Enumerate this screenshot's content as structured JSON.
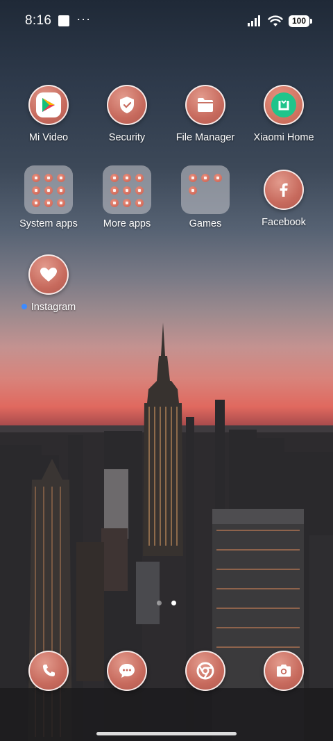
{
  "status_bar": {
    "time": "8:16",
    "more": "···",
    "battery": "100",
    "icons": [
      "notification-square-icon",
      "signal-icon",
      "wifi-icon",
      "battery-icon"
    ]
  },
  "apps": [
    {
      "label": "Mi Video",
      "icon": "play-icon"
    },
    {
      "label": "Security",
      "icon": "shield-check-icon"
    },
    {
      "label": "File Manager",
      "icon": "folder-icon"
    },
    {
      "label": "Xiaomi Home",
      "icon": "mi-home-icon"
    },
    {
      "label": "System apps",
      "icon": "folder-group-icon"
    },
    {
      "label": "More apps",
      "icon": "folder-group-icon"
    },
    {
      "label": "Games",
      "icon": "folder-group-icon"
    },
    {
      "label": "Facebook",
      "icon": "facebook-icon"
    },
    {
      "label": "Instagram",
      "icon": "heart-icon",
      "new_install_dot": true
    }
  ],
  "dock": [
    {
      "name": "phone",
      "icon": "phone-icon"
    },
    {
      "name": "messages",
      "icon": "message-icon"
    },
    {
      "name": "chrome",
      "icon": "chrome-icon"
    },
    {
      "name": "camera",
      "icon": "camera-icon"
    }
  ],
  "page_indicator": {
    "pages": 2,
    "active": 2
  },
  "colors": {
    "icon_fill": "#c76a5d",
    "dot_new": "#3d8bff"
  }
}
